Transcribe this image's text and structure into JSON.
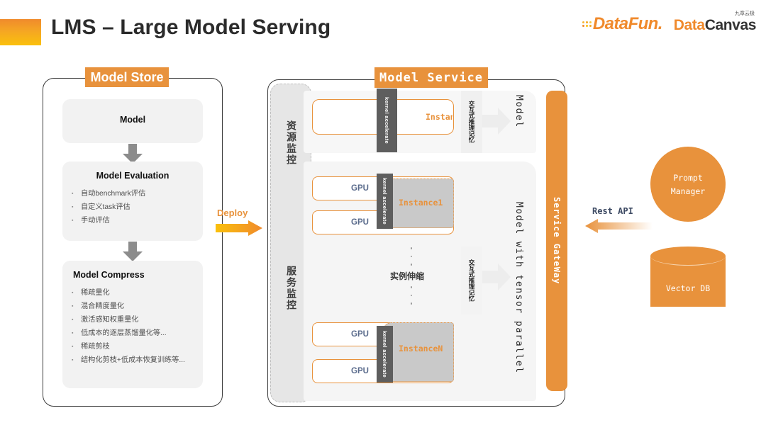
{
  "header": {
    "title": "LMS – Large Model Serving",
    "logos": {
      "datafun": "DataFun.",
      "datacanvas_primary": "Data",
      "datacanvas_secondary": "Canvas",
      "datacanvas_cn": "九章云极"
    }
  },
  "colors": {
    "accent_orange": "#E8923C",
    "accent_gold": "#FAC00C",
    "panel_border": "#3b3b3b",
    "card_gray": "#F2F2F2",
    "kernel_gray": "#5E5E5E",
    "instance_gray": "#C9C9C9",
    "gpu_text": "#5A6B8C"
  },
  "model_store": {
    "tab_label": "Model Store",
    "cards": [
      {
        "title": "Model",
        "bullets": []
      },
      {
        "title": "Model Evaluation",
        "bullets": [
          "自动benchmark评估",
          "自定义task评估",
          "手动评估"
        ]
      },
      {
        "title": "Model Compress",
        "bullets": [
          "稀疏量化",
          "混合精度量化",
          "激活感知权重量化",
          "低成本的逐层蒸馏量化等...",
          "稀疏剪枝",
          "结构化剪枝+低成本恢复训练等..."
        ]
      }
    ]
  },
  "deploy": {
    "label": "Deploy"
  },
  "model_service": {
    "tab_label": "Model Service",
    "monitor_labels": {
      "resource": "资源监控",
      "service": "服务监控"
    },
    "region_labels": {
      "single": "Model",
      "tensor": "Model with tensor parallel"
    },
    "memory_label": "交互式推理记忆",
    "gpu_label": "GPU",
    "kernel_label": "kernel accelerate",
    "instances": [
      {
        "name": "Instance",
        "gpus": 1
      },
      {
        "name": "Instance1",
        "gpus": 2
      },
      {
        "name": "InstanceN",
        "gpus": 2
      }
    ],
    "scale_text": "实例伸缩"
  },
  "service_gateway": {
    "label": "Service GateWay"
  },
  "right_column": {
    "prompt_manager": {
      "line1": "Prompt",
      "line2": "Manager"
    },
    "vector_db": {
      "label": "Vector DB"
    },
    "rest_api": {
      "label": "Rest API"
    }
  }
}
